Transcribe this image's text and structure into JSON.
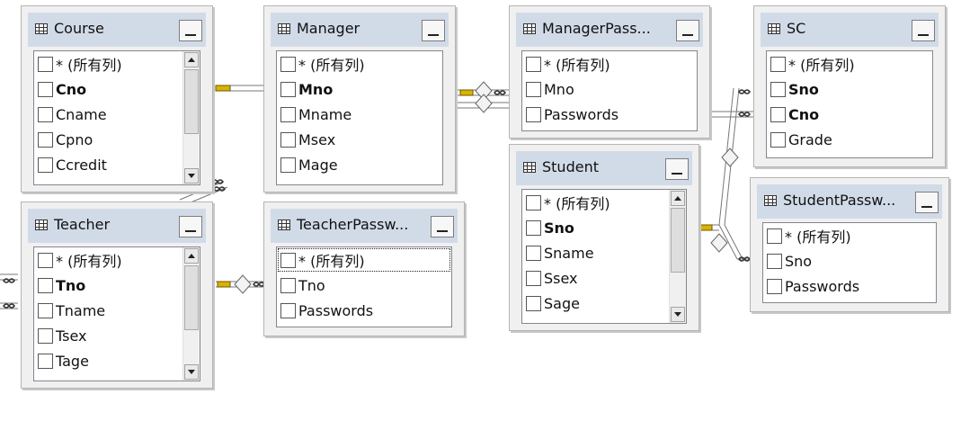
{
  "tables": {
    "course": {
      "title": "Course",
      "rows": [
        {
          "label": "* (所有列)",
          "key": false
        },
        {
          "label": "Cno",
          "key": true
        },
        {
          "label": "Cname",
          "key": false
        },
        {
          "label": "Cpno",
          "key": false
        },
        {
          "label": "Ccredit",
          "key": false
        }
      ]
    },
    "manager": {
      "title": "Manager",
      "rows": [
        {
          "label": "* (所有列)",
          "key": false
        },
        {
          "label": "Mno",
          "key": true
        },
        {
          "label": "Mname",
          "key": false
        },
        {
          "label": "Msex",
          "key": false
        },
        {
          "label": "Mage",
          "key": false
        }
      ]
    },
    "manager_passwords": {
      "title": "ManagerPass...",
      "rows": [
        {
          "label": "* (所有列)",
          "key": false
        },
        {
          "label": "Mno",
          "key": false
        },
        {
          "label": "Passwords",
          "key": false
        }
      ]
    },
    "sc": {
      "title": "SC",
      "rows": [
        {
          "label": "* (所有列)",
          "key": false
        },
        {
          "label": "Sno",
          "key": true
        },
        {
          "label": "Cno",
          "key": true
        },
        {
          "label": "Grade",
          "key": false
        }
      ]
    },
    "teacher": {
      "title": "Teacher",
      "rows": [
        {
          "label": "* (所有列)",
          "key": false
        },
        {
          "label": "Tno",
          "key": true
        },
        {
          "label": "Tname",
          "key": false
        },
        {
          "label": "Tsex",
          "key": false
        },
        {
          "label": "Tage",
          "key": false
        }
      ]
    },
    "teacher_passwords": {
      "title": "TeacherPassw...",
      "rows": [
        {
          "label": "* (所有列)",
          "key": false
        },
        {
          "label": "Tno",
          "key": false
        },
        {
          "label": "Passwords",
          "key": false
        }
      ]
    },
    "student": {
      "title": "Student",
      "rows": [
        {
          "label": "* (所有列)",
          "key": false
        },
        {
          "label": "Sno",
          "key": true
        },
        {
          "label": "Sname",
          "key": false
        },
        {
          "label": "Ssex",
          "key": false
        },
        {
          "label": "Sage",
          "key": false
        }
      ]
    },
    "student_passwords": {
      "title": "StudentPassw...",
      "rows": [
        {
          "label": "* (所有列)",
          "key": false
        },
        {
          "label": "Sno",
          "key": false
        },
        {
          "label": "Passwords",
          "key": false
        }
      ]
    }
  }
}
